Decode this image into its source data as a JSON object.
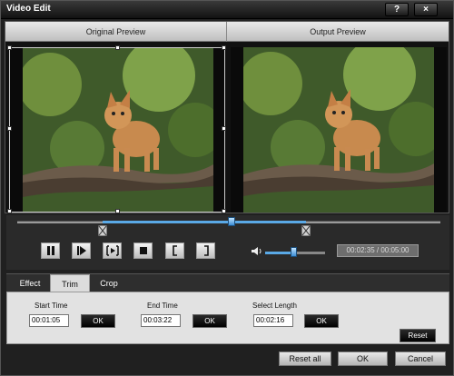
{
  "window": {
    "title": "Video Edit"
  },
  "titlebar": {
    "help_glyph": "?",
    "close_glyph": "×",
    "help_icon": "help-icon",
    "close_icon": "close-icon"
  },
  "preview": {
    "original_label": "Original Preview",
    "output_label": "Output Preview"
  },
  "timeline": {
    "position_fraction": 0.52,
    "trim_start_fraction": 0.21,
    "trim_end_fraction": 0.69
  },
  "controls": {
    "buttons": [
      "pause-icon",
      "step-forward-icon",
      "snapshot-icon",
      "stop-icon",
      "set-start-icon",
      "set-end-icon"
    ],
    "volume_fraction": 0.45,
    "time_display": "00:02:35 / 00:05:00"
  },
  "tabs": [
    {
      "label": "Effect",
      "active": false
    },
    {
      "label": "Trim",
      "active": true
    },
    {
      "label": "Crop",
      "active": false
    }
  ],
  "trim": {
    "start_label": "Start Time",
    "start_value": "00:01:05",
    "end_label": "End Time",
    "end_value": "00:03:22",
    "length_label": "Select Length",
    "length_value": "00:02:16",
    "ok_label": "OK",
    "reset_label": "Reset"
  },
  "footer": {
    "reset_all": "Reset all",
    "ok": "OK",
    "cancel": "Cancel"
  },
  "colors": {
    "accent": "#5aa9e6",
    "window_bg": "#202020",
    "panel_bg": "#e2e2e2"
  }
}
